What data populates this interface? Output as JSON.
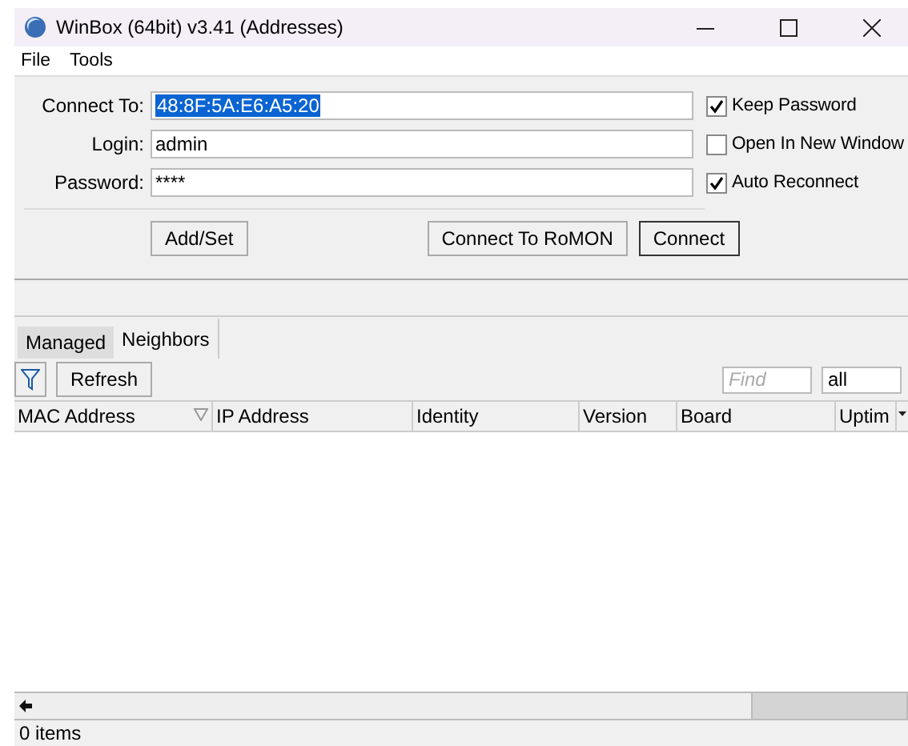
{
  "window": {
    "title": "WinBox (64bit) v3.41 (Addresses)"
  },
  "menu": [
    "File",
    "Tools"
  ],
  "fields": [
    {
      "label": "Connect To:",
      "value": "48:8F:5A:E6:A5:20",
      "selected": true
    },
    {
      "label": "Login:",
      "value": "admin",
      "selected": false
    },
    {
      "label": "Password:",
      "value": "****",
      "selected": false
    }
  ],
  "options": [
    {
      "label": "Keep Password",
      "checked": true
    },
    {
      "label": "Open In New Window",
      "checked": false
    },
    {
      "label": "Auto Reconnect",
      "checked": true
    }
  ],
  "buttons": [
    {
      "label": "Add/Set",
      "default": false
    },
    {
      "label": "Connect To RoMON",
      "default": false
    },
    {
      "label": "Connect",
      "default": true
    }
  ],
  "tabs": [
    {
      "label": "Managed",
      "selected": false
    },
    {
      "label": "Neighbors",
      "selected": true
    }
  ],
  "toolbar": {
    "refresh": "Refresh",
    "find_placeholder": "Find",
    "filter": "all"
  },
  "table": {
    "columns": [
      {
        "label": "MAC Address",
        "sorted": true
      },
      {
        "label": "IP Address",
        "sorted": false
      },
      {
        "label": "Identity",
        "sorted": false
      },
      {
        "label": "Version",
        "sorted": false
      },
      {
        "label": "Board",
        "sorted": false
      },
      {
        "label": "Uptim",
        "sorted": false
      }
    ]
  },
  "status_bar": "0 items"
}
